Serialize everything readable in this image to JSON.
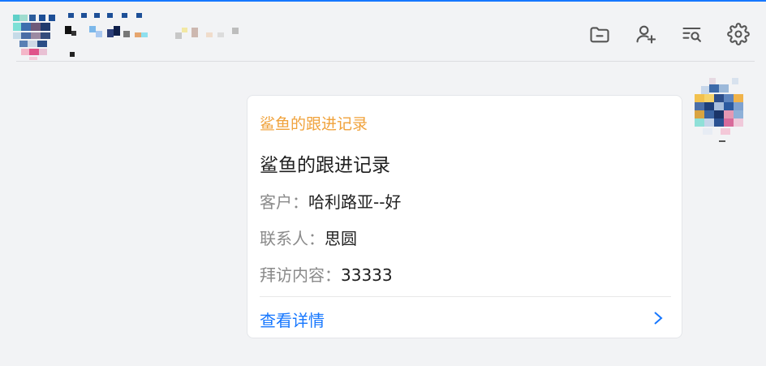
{
  "header": {
    "accent_color": "#1677ff",
    "toolbar": [
      {
        "icon": "folder-minus-icon",
        "name": "folder-button"
      },
      {
        "icon": "add-user-icon",
        "name": "add-member-button"
      },
      {
        "icon": "search-list-icon",
        "name": "search-records-button"
      },
      {
        "icon": "gear-icon",
        "name": "settings-button"
      }
    ]
  },
  "card": {
    "head_label": "鲨鱼的跟进记录",
    "title": "鲨鱼的跟进记录",
    "customer_key": "客户：",
    "customer_value": "哈利路亚--好",
    "contact_key": "联系人：",
    "contact_value": "思圆",
    "visit_key": "拜访内容：",
    "visit_value": "33333",
    "detail_link": "查看详情",
    "head_color": "#f0a23b",
    "link_color": "#1677ff"
  }
}
